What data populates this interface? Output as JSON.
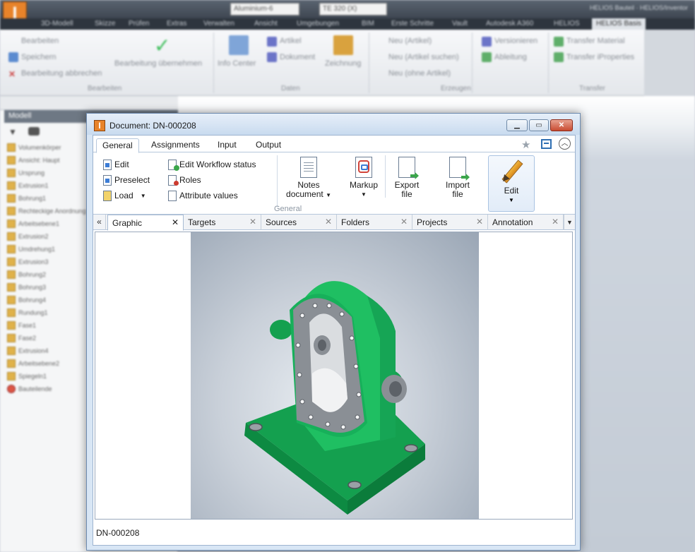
{
  "background": {
    "combo_material": "Aluminium-6",
    "combo_color": "TE 320 (X)",
    "title": "HELIOS Bauteil · HELIOS/Inventor",
    "menu_tabs": [
      "3D-Modell",
      "Skizze",
      "Prüfen",
      "Extras",
      "Verwalten",
      "Ansicht",
      "Umgebungen",
      "BIM",
      "Erste Schritte",
      "Vault",
      "Autodesk A360",
      "HELIOS"
    ],
    "menu_active": "HELIOS Basis",
    "ribbon": {
      "bearbeiten": "Bearbeiten",
      "speichern": "Speichern",
      "abbrechen": "Bearbeitung abbrechen",
      "uebernehmen": "Bearbeitung übernehmen",
      "info_center": "Info Center",
      "artikel": "Artikel",
      "dokument": "Dokument",
      "zeichnung": "Zeichnung",
      "neu_artikel": "Neu (Artikel)",
      "neu_artikel_suchen": "Neu (Artikel suchen)",
      "neu_ohne_artikel": "Neu (ohne Artikel)",
      "versionieren": "Versionieren",
      "ableitung": "Ableitung",
      "transfer_material": "Transfer Material",
      "transfer_properties": "Transfer iProperties",
      "group_bearbeiten": "Bearbeiten",
      "group_daten": "Daten",
      "group_erzeugen": "Erzeugen",
      "group_transfer": "Transfer"
    },
    "panel_header": "Modell",
    "tree": [
      "Volumenkörper",
      "Ansicht: Haupt",
      "Ursprung",
      "Extrusion1",
      "Bohrung1",
      "Rechteckige Anordnung",
      "Arbeitsebene1",
      "Extrusion2",
      "Umdrehung1",
      "Extrusion3",
      "Bohrung2",
      "Bohrung3",
      "Bohrung4",
      "Rundung1",
      "Fase1",
      "Fase2",
      "Extrusion4",
      "Arbeitsebene2",
      "Spiegeln1",
      "Bauteilende"
    ]
  },
  "dialog": {
    "title": "Document: DN-000208",
    "ribbon_tabs": [
      "General",
      "Assignments",
      "Input",
      "Output"
    ],
    "active_tab": "General",
    "buttons": {
      "edit": "Edit",
      "preselect": "Preselect",
      "load": "Load",
      "edit_workflow_status": "Edit Workflow status",
      "roles": "Roles",
      "attribute_values": "Attribute values",
      "notes_document_1": "Notes",
      "notes_document_2": "document",
      "markup": "Markup",
      "export_file_1": "Export",
      "export_file_2": "file",
      "import_file_1": "Import",
      "import_file_2": "file",
      "edit_big": "Edit"
    },
    "group_label": "General",
    "doc_tabs": [
      "Graphic",
      "Targets",
      "Sources",
      "Folders",
      "Projects",
      "Annotation"
    ],
    "active_doc_tab": "Graphic",
    "status": "DN-000208"
  },
  "colors": {
    "part_green": "#1fbf62",
    "part_grey": "#8a8f95",
    "dialog_frame": "#d8e6f5",
    "close_button": "#c84b31"
  }
}
